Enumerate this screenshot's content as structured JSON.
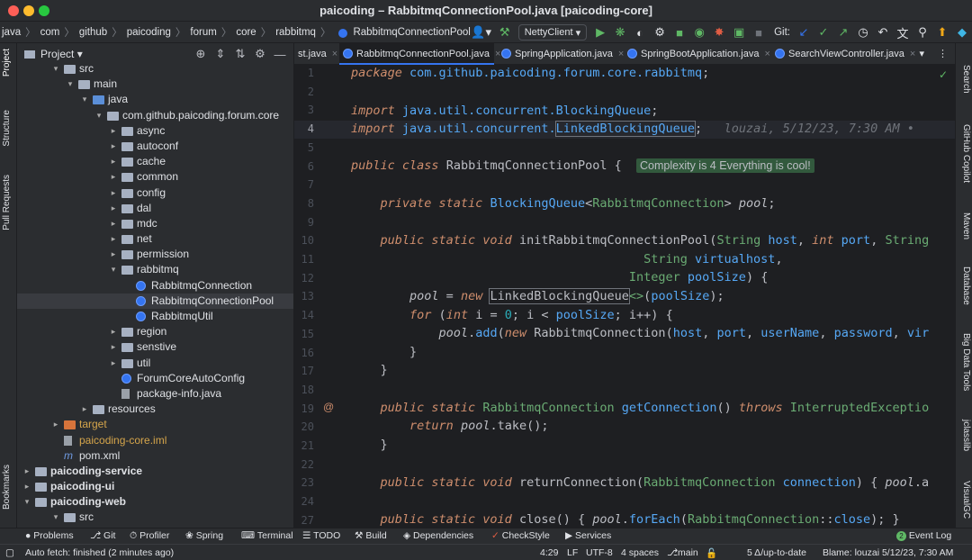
{
  "window": {
    "title": "paicoding – RabbitmqConnectionPool.java [paicoding-core]"
  },
  "breadcrumb": [
    "java",
    "com",
    "github",
    "paicoding",
    "forum",
    "core",
    "rabbitmq",
    "RabbitmqConnectionPool"
  ],
  "toolbar": {
    "run_config": "NettyClient",
    "git_label": "Git:"
  },
  "left_strip": [
    "Project",
    "Structure",
    "Pull Requests",
    "Bookmarks"
  ],
  "right_strip": [
    "Search",
    "GitHub Copilot",
    "Maven",
    "Database",
    "Big Data Tools",
    "jclasslib",
    "VisualGC"
  ],
  "project": {
    "title": "Project",
    "tree": [
      {
        "label": "src",
        "depth": 3,
        "kind": "folder",
        "arrow": "open"
      },
      {
        "label": "main",
        "depth": 4,
        "kind": "folder",
        "arrow": "open"
      },
      {
        "label": "java",
        "depth": 5,
        "kind": "folder-blue",
        "arrow": "open"
      },
      {
        "label": "com.github.paicoding.forum.core",
        "depth": 6,
        "kind": "folder",
        "arrow": "open"
      },
      {
        "label": "async",
        "depth": 7,
        "kind": "folder",
        "arrow": "closed"
      },
      {
        "label": "autoconf",
        "depth": 7,
        "kind": "folder",
        "arrow": "closed"
      },
      {
        "label": "cache",
        "depth": 7,
        "kind": "folder",
        "arrow": "closed"
      },
      {
        "label": "common",
        "depth": 7,
        "kind": "folder",
        "arrow": "closed"
      },
      {
        "label": "config",
        "depth": 7,
        "kind": "folder",
        "arrow": "closed"
      },
      {
        "label": "dal",
        "depth": 7,
        "kind": "folder",
        "arrow": "closed"
      },
      {
        "label": "mdc",
        "depth": 7,
        "kind": "folder",
        "arrow": "closed"
      },
      {
        "label": "net",
        "depth": 7,
        "kind": "folder",
        "arrow": "closed"
      },
      {
        "label": "permission",
        "depth": 7,
        "kind": "folder",
        "arrow": "closed"
      },
      {
        "label": "rabbitmq",
        "depth": 7,
        "kind": "folder",
        "arrow": "open"
      },
      {
        "label": "RabbitmqConnection",
        "depth": 8,
        "kind": "class",
        "arrow": ""
      },
      {
        "label": "RabbitmqConnectionPool",
        "depth": 8,
        "kind": "class",
        "arrow": "",
        "selected": true
      },
      {
        "label": "RabbitmqUtil",
        "depth": 8,
        "kind": "class",
        "arrow": ""
      },
      {
        "label": "region",
        "depth": 7,
        "kind": "folder",
        "arrow": "closed"
      },
      {
        "label": "senstive",
        "depth": 7,
        "kind": "folder",
        "arrow": "closed"
      },
      {
        "label": "util",
        "depth": 7,
        "kind": "folder",
        "arrow": "closed"
      },
      {
        "label": "ForumCoreAutoConfig",
        "depth": 7,
        "kind": "class",
        "arrow": ""
      },
      {
        "label": "package-info.java",
        "depth": 7,
        "kind": "file",
        "arrow": ""
      },
      {
        "label": "resources",
        "depth": 5,
        "kind": "folder",
        "arrow": "closed"
      },
      {
        "label": "target",
        "depth": 3,
        "kind": "folder-orange",
        "arrow": "closed",
        "color": "#d5a54b"
      },
      {
        "label": "paicoding-core.iml",
        "depth": 3,
        "kind": "file",
        "arrow": "",
        "color": "#d5a54b"
      },
      {
        "label": "pom.xml",
        "depth": 3,
        "kind": "maven",
        "arrow": ""
      },
      {
        "label": "paicoding-service",
        "depth": 1,
        "kind": "folder",
        "arrow": "closed",
        "bold": true
      },
      {
        "label": "paicoding-ui",
        "depth": 1,
        "kind": "folder",
        "arrow": "closed",
        "bold": true
      },
      {
        "label": "paicoding-web",
        "depth": 1,
        "kind": "folder",
        "arrow": "open",
        "bold": true
      },
      {
        "label": "src",
        "depth": 3,
        "kind": "folder",
        "arrow": "open"
      }
    ]
  },
  "tabs": [
    {
      "label": "st.java",
      "active": false
    },
    {
      "label": "RabbitmqConnectionPool.java",
      "active": true
    },
    {
      "label": "SpringApplication.java",
      "active": false
    },
    {
      "label": "SpringBootApplication.java",
      "active": false
    },
    {
      "label": "SearchViewController.java",
      "active": false
    }
  ],
  "editor": {
    "line_numbers": [
      "1",
      "2",
      "3",
      "4",
      "5",
      "6",
      "7",
      "8",
      "9",
      "10",
      "11",
      "12",
      "13",
      "14",
      "15",
      "16",
      "17",
      "18",
      "19",
      "20",
      "21",
      "22",
      "23",
      "24",
      "27"
    ],
    "current_line": "4",
    "blame_hint": "louzai, 5/12/23, 7:30 AM",
    "complexity_badge": "Complexity is 4 Everything is cool!",
    "gutter_marker": "@"
  },
  "bottom_tools": [
    "Problems",
    "Git",
    "Profiler",
    "Spring",
    "Terminal",
    "TODO",
    "Build",
    "Dependencies",
    "CheckStyle",
    "Services",
    "Event Log"
  ],
  "event_log_count": "2",
  "status": {
    "left": "Auto fetch: finished (2 minutes ago)",
    "position": "4:29",
    "line_sep": "LF",
    "encoding": "UTF-8",
    "indent": "4 spaces",
    "branch": "main",
    "vcs": "5 Δ/up-to-date",
    "blame": "Blame: louzai 5/12/23, 7:30 AM"
  }
}
